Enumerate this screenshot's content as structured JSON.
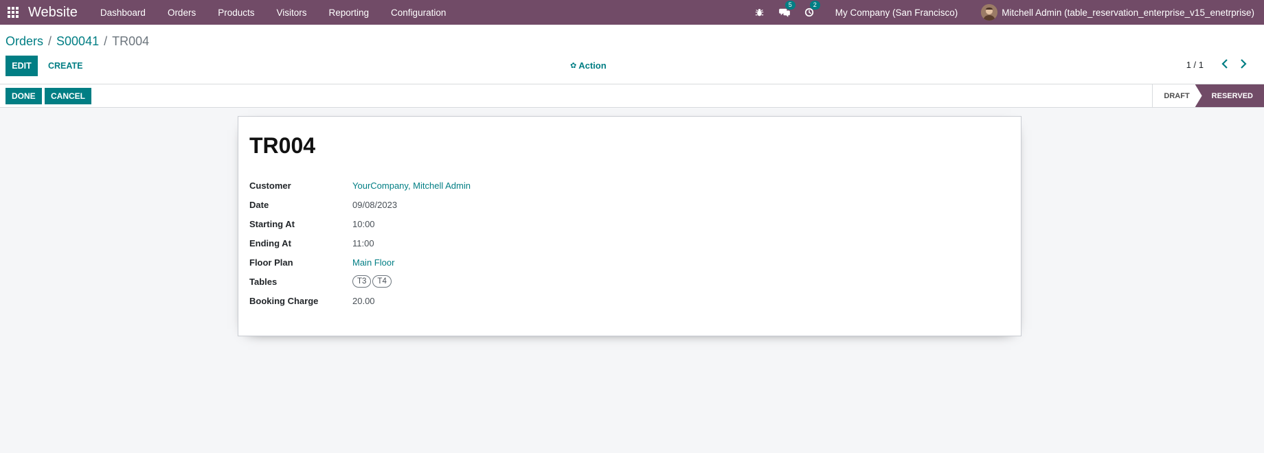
{
  "navbar": {
    "app_name": "Website",
    "menu": [
      "Dashboard",
      "Orders",
      "Products",
      "Visitors",
      "Reporting",
      "Configuration"
    ],
    "messages_count": "5",
    "activities_count": "2",
    "company": "My Company (San Francisco)",
    "user": "Mitchell Admin (table_reservation_enterprise_v15_enetrprise)"
  },
  "breadcrumb": {
    "items": [
      "Orders",
      "S00041"
    ],
    "current": "TR004"
  },
  "toolbar": {
    "edit_label": "EDIT",
    "create_label": "CREATE",
    "action_label": "Action",
    "pager": "1 / 1"
  },
  "statusbar": {
    "done_label": "DONE",
    "cancel_label": "CANCEL",
    "stages": [
      "DRAFT",
      "RESERVED"
    ],
    "active_stage": "RESERVED"
  },
  "record": {
    "name": "TR004",
    "fields": [
      {
        "label": "Customer",
        "value": "YourCompany, Mitchell Admin",
        "link": true
      },
      {
        "label": "Date",
        "value": "09/08/2023",
        "link": false
      },
      {
        "label": "Starting At",
        "value": "10:00",
        "link": false
      },
      {
        "label": "Ending At",
        "value": "11:00",
        "link": false
      },
      {
        "label": "Floor Plan",
        "value": "Main Floor",
        "link": true
      },
      {
        "label": "Tables",
        "tags": [
          "T3",
          "T4"
        ]
      },
      {
        "label": "Booking Charge",
        "value": "20.00",
        "link": false
      }
    ]
  },
  "colors": {
    "brand": "#714b67",
    "accent": "#017e84"
  }
}
